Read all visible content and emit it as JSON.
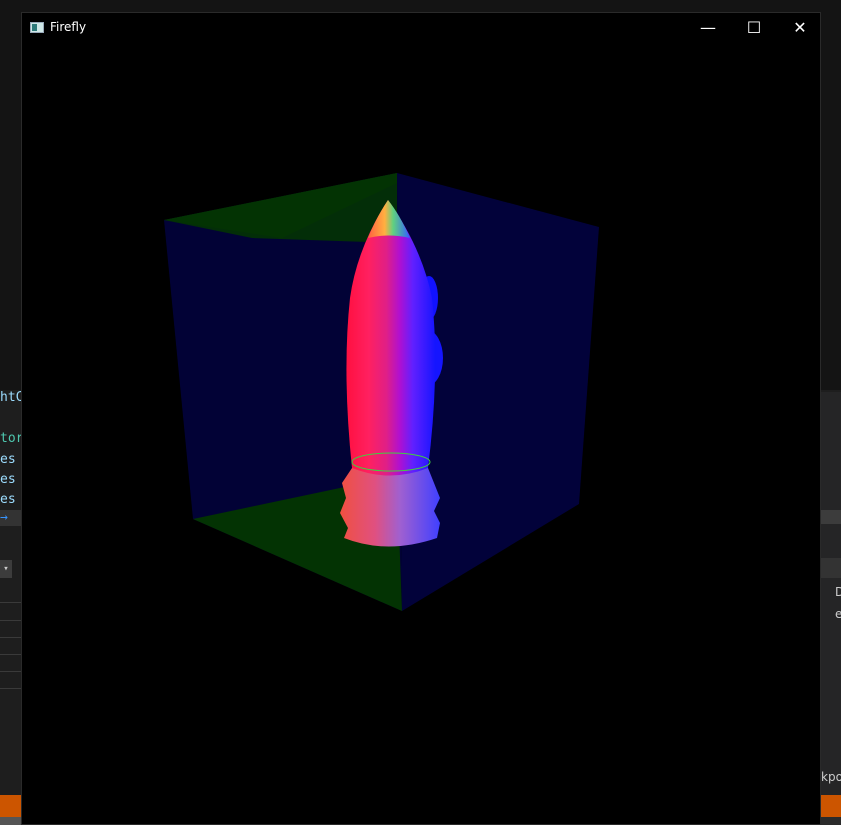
{
  "window": {
    "title": "Firefly",
    "minimize_glyph": "—",
    "maximize_glyph": "☐",
    "close_glyph": "✕"
  },
  "background_ide": {
    "code_lines": [
      "htC",
      "",
      "tor",
      "es",
      "es",
      "es"
    ],
    "arrow_glyph": "→",
    "dropdown_glyph": "▾",
    "right_column_header": "D",
    "right_column_cell": "e",
    "right_bottom_text": "kpoi"
  },
  "scene": {
    "box_back_color": "#02023a",
    "box_floor_color": "#033303",
    "box_left_color": "#020236",
    "rocket_colors": [
      "#ff0040",
      "#ff2070",
      "#e0208a",
      "#c000c8",
      "#8000ff",
      "#3020ff",
      "#1010ff"
    ]
  }
}
